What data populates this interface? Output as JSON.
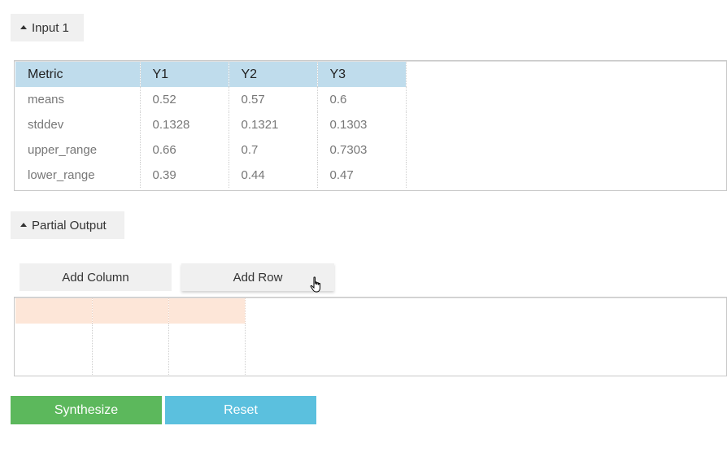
{
  "input_section": {
    "label": "Input 1",
    "table": {
      "headers": [
        "Metric",
        "Y1",
        "Y2",
        "Y3"
      ],
      "rows": [
        [
          "means",
          "0.52",
          "0.57",
          "0.6"
        ],
        [
          "stddev",
          "0.1328",
          "0.1321",
          "0.1303"
        ],
        [
          "upper_range",
          "0.66",
          "0.7",
          "0.7303"
        ],
        [
          "lower_range",
          "0.39",
          "0.44",
          "0.47"
        ]
      ]
    }
  },
  "output_section": {
    "label": "Partial Output",
    "add_column_label": "Add Column",
    "add_row_label": "Add Row"
  },
  "actions": {
    "synthesize_label": "Synthesize",
    "reset_label": "Reset"
  },
  "colors": {
    "header_blue": "#bfdcec",
    "header_peach": "#fde6d8",
    "synthesize_green": "#5cb85c",
    "reset_blue": "#5bc0de"
  },
  "icons": {
    "collapse": "triangle-up-icon",
    "cursor": "hand-pointer-icon"
  }
}
